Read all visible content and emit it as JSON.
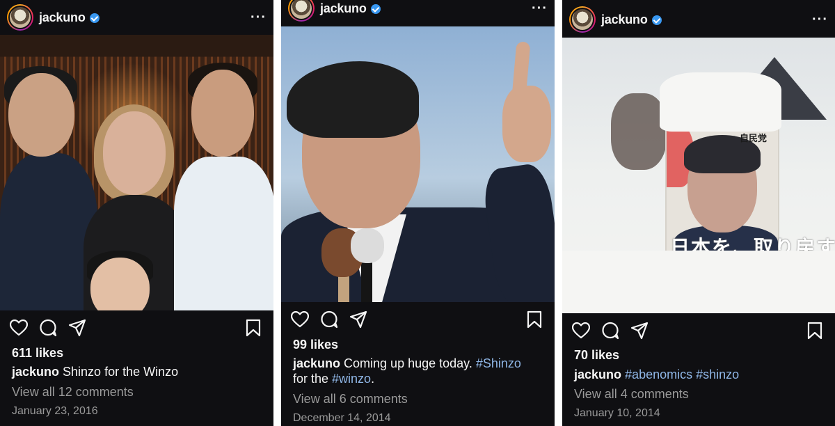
{
  "posts": [
    {
      "username": "jackuno",
      "more_icon": "more-options-icon",
      "likes": "611 likes",
      "caption_user": "jackuno",
      "caption_text": " Shinzo for the Winzo",
      "comments": "View all 12 comments",
      "date": "January 23, 2016"
    },
    {
      "username": "jackuno",
      "more_icon": "more-options-icon",
      "likes": "99 likes",
      "caption_user": "jackuno",
      "caption_text_1": " Coming up huge today. ",
      "caption_tag_1": "#Shinzo",
      "caption_text_2": "for the ",
      "caption_tag_2": "#winzo",
      "caption_text_3": ".",
      "comments": "View all 6 comments",
      "date": "December 14, 2014"
    },
    {
      "username": "jackuno",
      "more_icon": "more-options-icon",
      "likes": "70 likes",
      "caption_user": "jackuno",
      "caption_tag_1": "#abenomics",
      "caption_tag_2": "#shinzo",
      "poster_party": "自民党",
      "poster_text": "日本を、取り戻す",
      "comments": "View all 4 comments",
      "date": "January 10, 2014"
    }
  ],
  "more_glyph": "···",
  "icons": {
    "like": "heart-icon",
    "comment": "comment-icon",
    "share": "share-icon",
    "save": "bookmark-icon"
  },
  "colors": {
    "background": "#0f0f12",
    "hashtag": "#8fb6e6",
    "verified": "#3897f0",
    "muted_text": "#9a9a9a"
  }
}
